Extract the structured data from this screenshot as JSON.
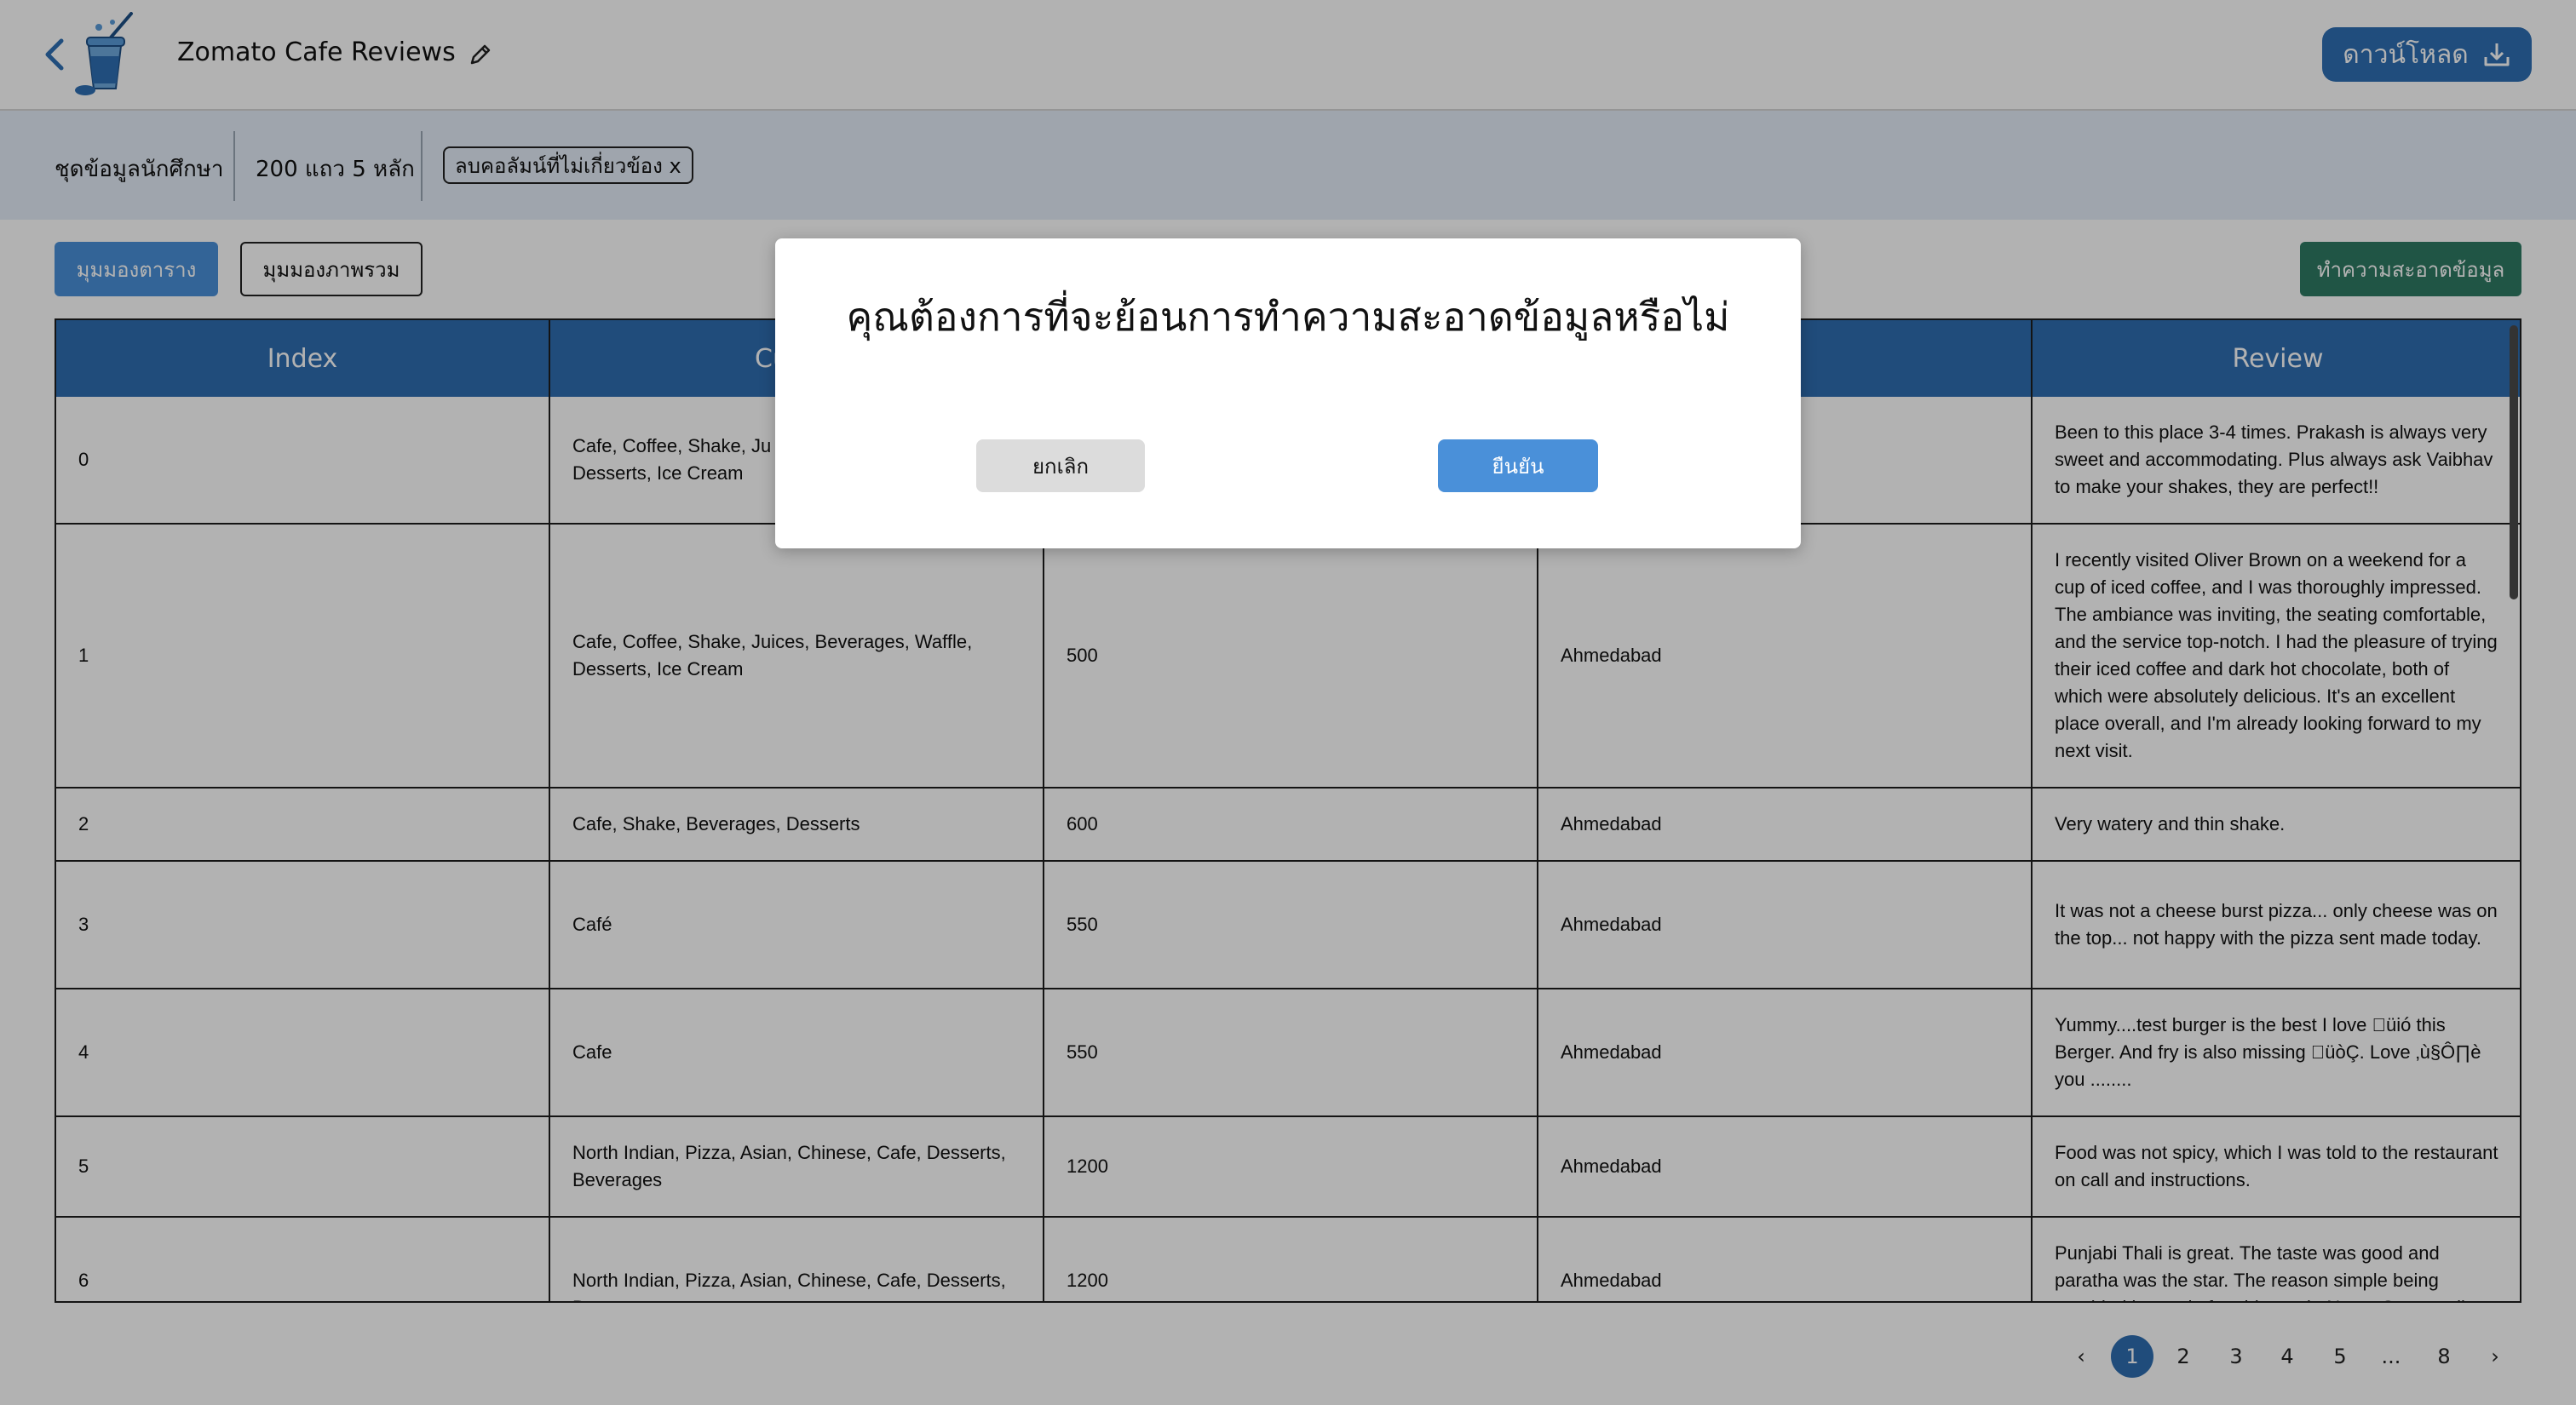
{
  "header": {
    "app_title": "Zomato Cafe Reviews",
    "download_label": "ดาวน์โหลด",
    "icons": [
      "chevron-left-icon",
      "cup-logo-icon",
      "pencil-icon",
      "download-icon"
    ]
  },
  "info_bar": {
    "dataset_label": "ชุดข้อมูลนักศึกษา",
    "size_label": "200 แถว 5 หลัก",
    "tag_label": "ลบคอลัมน์ที่ไม่เกี่ยวข้อง x"
  },
  "toolbar": {
    "table_view_label": "มุมมองตาราง",
    "overview_label": "มุมมองภาพรวม",
    "clean_label": "ทำความสะอาดข้อมูล"
  },
  "table": {
    "headers": [
      "Index",
      "Cu",
      "",
      "",
      "Review"
    ],
    "rows": [
      {
        "index": "0",
        "cuisine": "Cafe, Coffee, Shake, Ju\nDesserts, Ice Cream",
        "cost": "",
        "city": "",
        "review": "Been to this place 3-4 times. Prakash is always very sweet and accommodating. Plus always ask Vaibhav to make your shakes, they are perfect!!"
      },
      {
        "index": "1",
        "cuisine": "Cafe, Coffee, Shake, Juices, Beverages, Waffle, Desserts, Ice Cream",
        "cost": "500",
        "city": "Ahmedabad",
        "review": "I recently visited Oliver Brown on a weekend for a cup of iced coffee, and I was thoroughly impressed. The ambiance was inviting, the seating comfortable, and the service top-notch. I had the pleasure of trying their iced coffee and dark hot chocolate, both of which were absolutely delicious. It's an excellent place overall, and I'm already looking forward to my next visit."
      },
      {
        "index": "2",
        "cuisine": "Cafe, Shake, Beverages, Desserts",
        "cost": "600",
        "city": "Ahmedabad",
        "review": "Very watery and thin shake."
      },
      {
        "index": "3",
        "cuisine": "Café",
        "cost": "550",
        "city": "Ahmedabad",
        "review": "It was not a cheese burst pizza... only cheese was on the top... not happy with the pizza sent made today."
      },
      {
        "index": "4",
        "cuisine": "Cafe",
        "cost": "550",
        "city": "Ahmedabad",
        "review": "Yummy....test burger is the best I love üió this Berger. And fry is also missing üòÇ. Love ‚ù§Ô∏è you ........"
      },
      {
        "index": "5",
        "cuisine": "North Indian, Pizza, Asian, Chinese, Cafe, Desserts, Beverages",
        "cost": "1200",
        "city": "Ahmedabad",
        "review": "Food was not spicy, which I was told to the restaurant on call and instructions."
      },
      {
        "index": "6",
        "cuisine": "North Indian, Pizza, Asian, Chinese, Cafe, Desserts, Beverages",
        "cost": "1200",
        "city": "Ahmedabad",
        "review": "Punjabi Thali is great. The taste was good and paratha was the star. The reason simple being provided instead of maida made Naan. So overall"
      }
    ]
  },
  "pagination": {
    "prev": "‹",
    "pages": [
      "1",
      "2",
      "3",
      "4",
      "5",
      "...",
      "8"
    ],
    "next": "›",
    "current": "1"
  },
  "modal": {
    "title": "คุณต้องการที่จะย้อนการทำความสะอาดข้อมูลหรือไม่",
    "cancel_label": "ยกเลิก",
    "confirm_label": "ยืนยัน"
  },
  "colors": {
    "primary": "#2f6db0",
    "accent_button": "#4a90d9",
    "clean_button": "#2f7a64",
    "info_bar": "#e4edf8"
  }
}
